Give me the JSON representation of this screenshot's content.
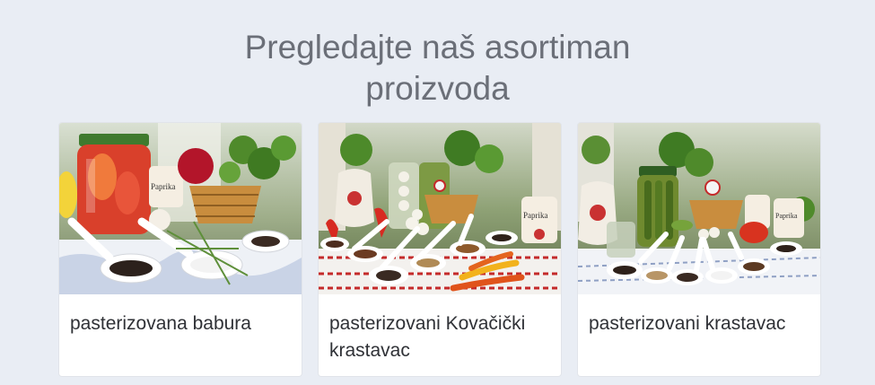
{
  "section": {
    "title_line1": "Pregledajte naš asortiman",
    "title_line2": "proizvoda"
  },
  "products": [
    {
      "name": "pasterizovana babura",
      "jar_label": "Paprika",
      "image_icon": "pickled-peppers-jar-photo"
    },
    {
      "name": "pasterizovani Kovačički krastavac",
      "jar_label": "Paprika",
      "image_icon": "pickled-cucumbers-spices-photo"
    },
    {
      "name": "pasterizovani krastavac",
      "jar_label": "Paprika",
      "image_icon": "pickled-cucumber-jar-photo"
    }
  ],
  "colors": {
    "background": "#e9edf4",
    "card": "#ffffff",
    "title": "#6b6f78",
    "label": "#2f3136"
  }
}
